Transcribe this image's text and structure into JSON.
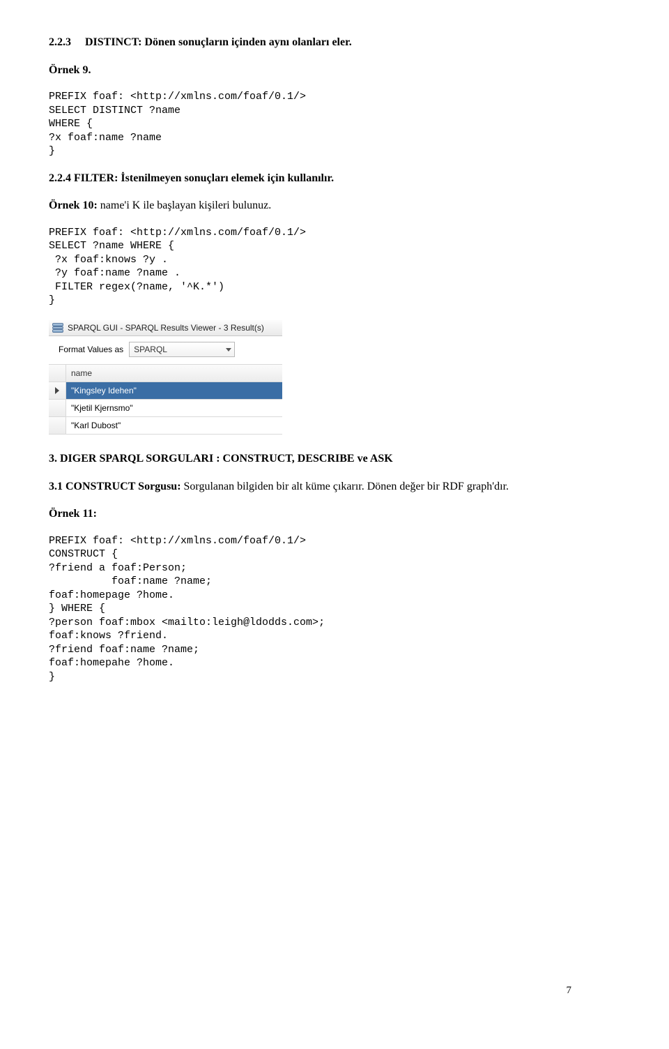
{
  "h1": {
    "num": "2.2.3",
    "title": "DISTINCT: Dönen sonuçların içinden aynı olanları eler."
  },
  "ex9": {
    "label": "Örnek 9.",
    "code": "PREFIX foaf: <http://xmlns.com/foaf/0.1/>\nSELECT DISTINCT ?name\nWHERE {\n?x foaf:name ?name\n}"
  },
  "h2": "2.2.4 FILTER: İstenilmeyen sonuçları elemek için kullanılır.",
  "ex10": {
    "label": "Örnek 10:",
    "label_rest": " name'i K ile başlayan kişileri bulunuz.",
    "code": "PREFIX foaf: <http://xmlns.com/foaf/0.1/>\nSELECT ?name WHERE {\n ?x foaf:knows ?y .\n ?y foaf:name ?name .\n FILTER regex(?name, '^K.*')\n}"
  },
  "sparql_window": {
    "title": "SPARQL GUI - SPARQL Results Viewer - 3 Result(s)",
    "format_label": "Format Values as",
    "format_value": "SPARQL",
    "column": "name",
    "rows": [
      "\"Kingsley Idehen\"",
      "\"Kjetil Kjernsmo\"",
      "\"Karl Dubost\""
    ]
  },
  "sec3": "3. DIGER SPARQL SORGULARI : CONSTRUCT, DESCRIBE ve ASK",
  "sec31": {
    "lead": "3.1 CONSTRUCT Sorgusu:",
    "rest": " Sorgulanan bilgiden bir alt küme çıkarır. Dönen değer bir RDF graph'dır."
  },
  "ex11": {
    "label": "Örnek 11:",
    "code": "PREFIX foaf: <http://xmlns.com/foaf/0.1/>\nCONSTRUCT {\n?friend a foaf:Person;\n          foaf:name ?name;\nfoaf:homepage ?home.\n} WHERE {\n?person foaf:mbox <mailto:leigh@ldodds.com>;\nfoaf:knows ?friend.\n?friend foaf:name ?name;\nfoaf:homepahe ?home.\n}"
  },
  "page_number": "7"
}
